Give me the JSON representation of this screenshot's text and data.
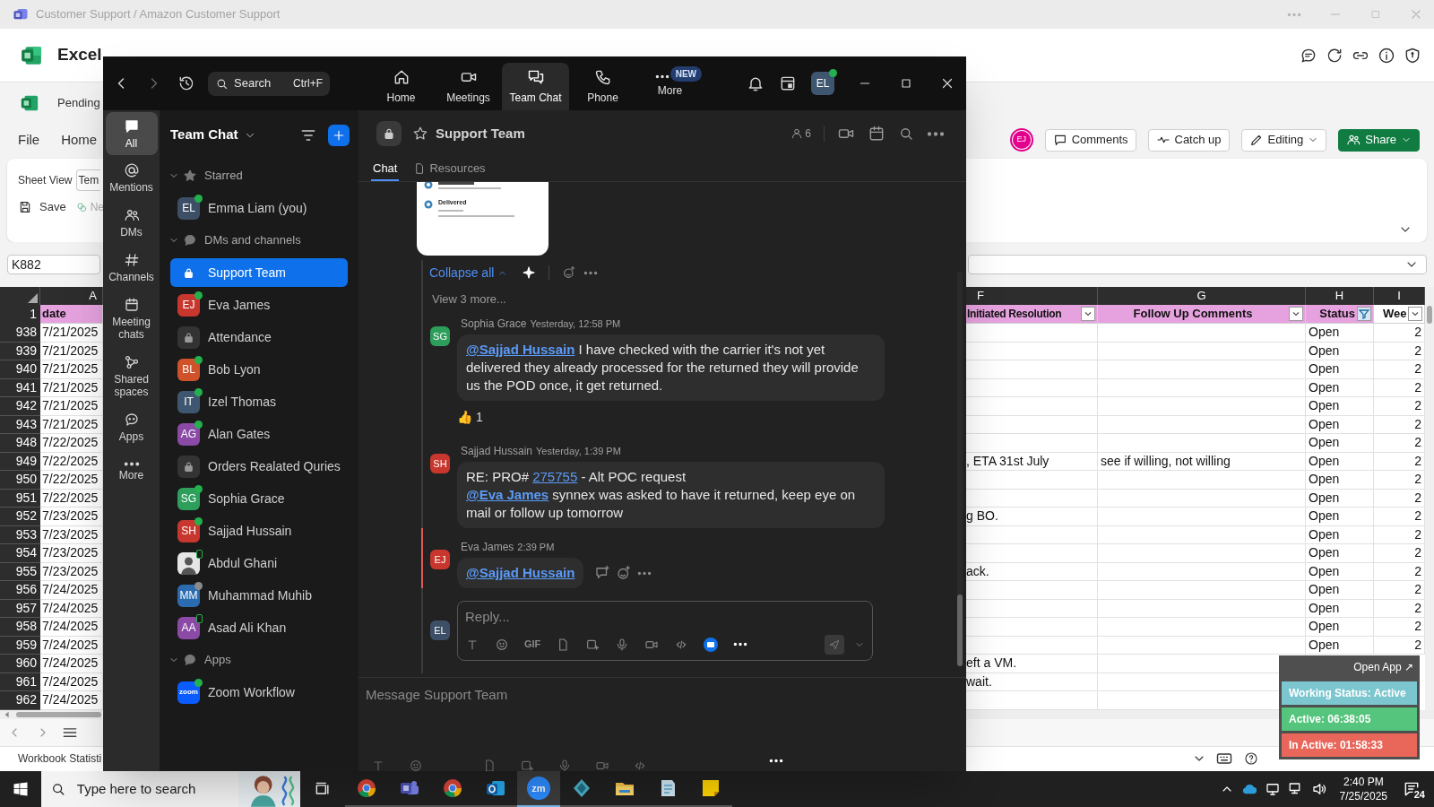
{
  "title_bar": {
    "title": "Customer Support / Amazon Customer Support"
  },
  "excel": {
    "app_name": "Excel",
    "document": "Pending",
    "menu": [
      "File",
      "Home"
    ],
    "collaborator": {
      "initials": "EJ",
      "color": "#e3008c"
    },
    "buttons": [
      {
        "label": "Comments",
        "kind": "comments"
      },
      {
        "label": "Catch up",
        "kind": "catchup"
      },
      {
        "label": "Editing",
        "kind": "editing"
      },
      {
        "label": "Share",
        "kind": "share"
      }
    ],
    "ribbon": {
      "sheet_view_label": "Sheet View",
      "sheet_view_value": "Tem",
      "save": "Save",
      "new": "Ne"
    },
    "name_box": "K882",
    "columns": [
      "A",
      "F",
      "G",
      "H",
      "I"
    ],
    "header_row": "1",
    "headers": [
      {
        "text": "date"
      },
      {
        "text": "Initiated Resolution",
        "filtered": false
      },
      {
        "text": "Follow Up Comments",
        "filtered": false
      },
      {
        "text": "Status",
        "filtered": true
      },
      {
        "text": "Wee",
        "filtered": false
      }
    ],
    "rows": [
      {
        "num": "938",
        "date": "7/21/2025",
        "status": "Open",
        "i": "2"
      },
      {
        "num": "939",
        "date": "7/21/2025",
        "status": "Open",
        "i": "2"
      },
      {
        "num": "940",
        "date": "7/21/2025",
        "status": "Open",
        "i": "2"
      },
      {
        "num": "941",
        "date": "7/21/2025",
        "status": "Open",
        "i": "2"
      },
      {
        "num": "942",
        "date": "7/21/2025",
        "status": "Open",
        "i": "2"
      },
      {
        "num": "943",
        "date": "7/21/2025",
        "status": "Open",
        "i": "2"
      },
      {
        "num": "948",
        "date": "7/22/2025",
        "status": "Open",
        "i": "2"
      },
      {
        "num": "949",
        "date": "7/22/2025",
        "f": ", ETA 31st July",
        "g": "see if willing, not willing",
        "status": "Open",
        "i": "2"
      },
      {
        "num": "950",
        "date": "7/22/2025",
        "status": "Open",
        "i": "2"
      },
      {
        "num": "951",
        "date": "7/22/2025",
        "status": "Open",
        "i": "2"
      },
      {
        "num": "952",
        "date": "7/23/2025",
        "f": "g BO.",
        "status": "Open",
        "i": "2"
      },
      {
        "num": "953",
        "date": "7/23/2025",
        "status": "Open",
        "i": "2"
      },
      {
        "num": "954",
        "date": "7/23/2025",
        "status": "Open",
        "i": "2"
      },
      {
        "num": "955",
        "date": "7/23/2025",
        "f": "ack.",
        "status": "Open",
        "i": "2"
      },
      {
        "num": "956",
        "date": "7/24/2025",
        "status": "Open",
        "i": "2"
      },
      {
        "num": "957",
        "date": "7/24/2025",
        "status": "Open",
        "i": "2"
      },
      {
        "num": "958",
        "date": "7/24/2025",
        "status": "Open",
        "i": "2"
      },
      {
        "num": "959",
        "date": "7/24/2025",
        "status": "Open",
        "i": "2"
      },
      {
        "num": "960",
        "date": "7/24/2025",
        "f": "eft a VM."
      },
      {
        "num": "961",
        "date": "7/24/2025",
        "f": "wait."
      },
      {
        "num": "962",
        "date": "7/24/2025"
      }
    ],
    "status_text": "Workbook Statisti"
  },
  "zoom": {
    "search": {
      "placeholder": "Search",
      "shortcut": "Ctrl+F"
    },
    "tabs": [
      {
        "label": "Home",
        "selected": false
      },
      {
        "label": "Meetings",
        "selected": false
      },
      {
        "label": "Team Chat",
        "selected": true
      },
      {
        "label": "Phone",
        "selected": false
      },
      {
        "label": "More",
        "selected": false,
        "badge": "NEW"
      }
    ],
    "user": {
      "initials": "EL",
      "online": true,
      "mobile": false
    },
    "nav": [
      {
        "label": "All",
        "selected": true
      },
      {
        "label": "Mentions",
        "selected": false
      },
      {
        "label": "DMs",
        "selected": false
      },
      {
        "label": "Channels",
        "selected": false
      },
      {
        "label": "Meeting chats",
        "selected": false
      },
      {
        "label": "Shared spaces",
        "selected": false
      },
      {
        "label": "Apps",
        "selected": false
      },
      {
        "label": "More",
        "selected": false
      }
    ],
    "list_title": "Team Chat",
    "sections": [
      {
        "title": "Starred",
        "expanded": true,
        "items": [
          {
            "name": "Emma Liam (you)",
            "kind": "person",
            "initials": "EL",
            "color": "#3d4f66",
            "online": true,
            "mobile": false,
            "selected": false
          }
        ]
      },
      {
        "title": "DMs and channels",
        "expanded": true,
        "items": [
          {
            "name": "Support Team",
            "kind": "channel",
            "selected": true
          },
          {
            "name": "Eva James",
            "kind": "person",
            "initials": "EJ",
            "color": "#c8372d",
            "online": true,
            "mobile": false,
            "selected": false
          },
          {
            "name": "Attendance",
            "kind": "channel",
            "selected": false
          },
          {
            "name": "Bob Lyon",
            "kind": "person",
            "initials": "BL",
            "color": "#d0522a",
            "online": true,
            "mobile": false,
            "selected": false
          },
          {
            "name": "Izel Thomas",
            "kind": "person",
            "initials": "IT",
            "color": "#3f5670",
            "online": true,
            "mobile": false,
            "selected": false
          },
          {
            "name": "Alan Gates",
            "kind": "person",
            "initials": "AG",
            "color": "#8a4aa5",
            "online": true,
            "mobile": false,
            "selected": false
          },
          {
            "name": "Orders Realated Quries",
            "kind": "channel",
            "selected": false
          },
          {
            "name": "Sophia Grace",
            "kind": "person",
            "initials": "SG",
            "color": "#2e9e5b",
            "online": true,
            "mobile": false,
            "selected": false
          },
          {
            "name": "Sajjad Hussain",
            "kind": "person",
            "initials": "SH",
            "color": "#c8372d",
            "online": true,
            "mobile": false,
            "selected": false
          },
          {
            "name": "Abdul Ghani",
            "online": true,
            "mobile": true,
            "selected": false
          },
          {
            "name": "Muhammad Muhib",
            "kind": "person",
            "initials": "MM",
            "color": "#2b6cb0",
            "online": false,
            "mobile": false,
            "selected": false
          },
          {
            "name": "Asad Ali Khan",
            "kind": "person",
            "initials": "AA",
            "color": "#8a4aa5",
            "online": true,
            "mobile": true,
            "selected": false
          }
        ]
      },
      {
        "title": "Apps",
        "expanded": true,
        "items": [
          {
            "name": "Zoom Workflow",
            "kind": "app",
            "initials": "zoom",
            "color": "#0b5cff",
            "online": true,
            "mobile": false,
            "selected": false
          }
        ]
      }
    ],
    "chat": {
      "title": "Support Team",
      "members": "6",
      "tabs": [
        {
          "label": "Chat",
          "selected": true
        },
        {
          "label": "Resources",
          "selected": false
        }
      ],
      "attachment": {
        "status": "Delivered"
      },
      "collapse": "Collapse all",
      "view_more": "View 3 more...",
      "messages": [
        {
          "author": "Sophia Grace",
          "time": "Yesterday, 12:58 PM",
          "initials": "SG",
          "color": "#2e9e5b",
          "new": false,
          "parts": [
            {
              "kind": "mention",
              "text": "@Sajjad Hussain"
            },
            {
              "kind": "text",
              "text": " I have checked with the carrier it's not yet delivered they already processed for the returned they will provide us the POD once, it get returned."
            }
          ],
          "reaction": {
            "emoji": "👍",
            "count": "1"
          }
        },
        {
          "author": "Sajjad Hussain",
          "time": "Yesterday, 1:39 PM",
          "initials": "SH",
          "color": "#c8372d",
          "new": false,
          "parts": [
            {
              "kind": "text",
              "text": "RE: PRO# "
            },
            {
              "kind": "link",
              "text": "275755"
            },
            {
              "kind": "text",
              "text": " - Alt POC request"
            },
            {
              "kind": "break"
            },
            {
              "kind": "mention",
              "text": "@Eva James"
            },
            {
              "kind": "text",
              "text": " synnex was asked to have it returned, keep eye on mail or follow up tomorrow"
            }
          ]
        },
        {
          "author": "Eva James",
          "time": "2:39 PM",
          "initials": "EJ",
          "color": "#c8372d",
          "new": true,
          "parts": [
            {
              "kind": "mention",
              "text": "@Sajjad Hussain"
            }
          ]
        }
      ],
      "reply": {
        "initials": "EL",
        "placeholder": "Reply...",
        "gif": "GIF"
      },
      "composer": {
        "placeholder": "Message Support Team"
      }
    }
  },
  "widget": {
    "open_app": "Open App ↗",
    "rows": [
      {
        "text": "Working Status: Active",
        "color": "#7cc6cf"
      },
      {
        "text": "Active: 06:38:05",
        "color": "#55c47c"
      },
      {
        "text": "In Active: 01:58:33",
        "color": "#e8665a"
      }
    ]
  },
  "taskbar": {
    "search_placeholder": "Type here to search",
    "apps": [
      {
        "kind": "chrome",
        "selected": false
      },
      {
        "kind": "teams",
        "selected": false
      },
      {
        "kind": "chrome",
        "selected": false
      },
      {
        "kind": "outlook",
        "selected": false
      },
      {
        "kind": "zoom",
        "label": "zm",
        "selected": true
      },
      {
        "kind": "diamond",
        "selected": false
      },
      {
        "kind": "explorer",
        "selected": false
      },
      {
        "kind": "notepad",
        "selected": false
      },
      {
        "kind": "sticky",
        "selected": false
      }
    ],
    "time": "2:40 PM",
    "date": "7/25/2025",
    "notifications": "24"
  }
}
